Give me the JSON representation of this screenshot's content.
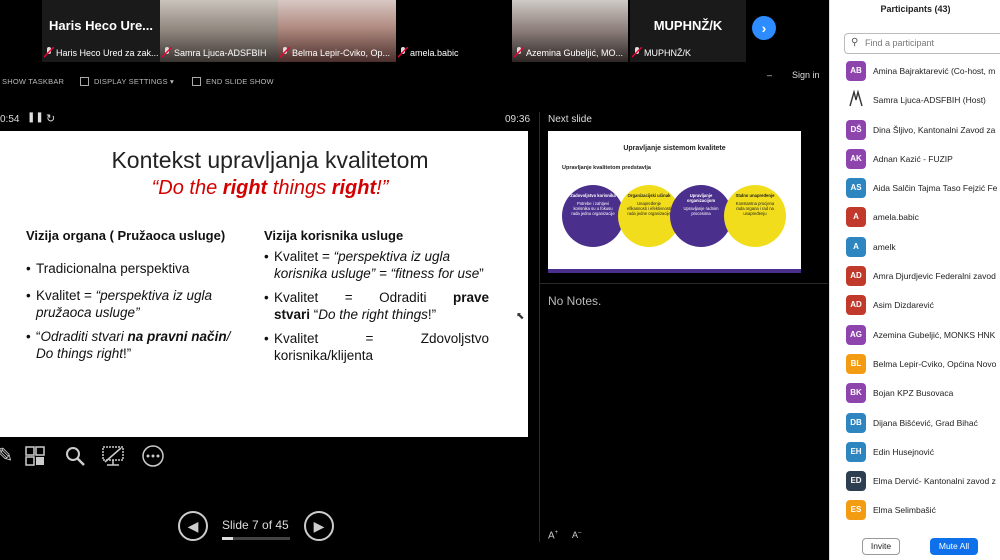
{
  "video_tiles": [
    {
      "name": "Haris Heco Ure...",
      "caption": "Haris Heco Ured za zak..."
    },
    {
      "name": "",
      "caption": "Samra Ljuca-ADSFBIH"
    },
    {
      "name": "",
      "caption": "Belma Lepir-Cviko, Op..."
    },
    {
      "name": "",
      "caption": "amela.babic"
    },
    {
      "name": "",
      "caption": "Azemina Gubeljić, MO..."
    },
    {
      "name": "MUPHNŽ/K",
      "caption": "MUPHNŽ/K"
    }
  ],
  "toolbar": {
    "show_taskbar": "SHOW TASKBAR",
    "display_settings": "DISPLAY SETTINGS ▾",
    "end_slide_show": "END SLIDE SHOW",
    "sign_in": "Sign in",
    "minimize": "–"
  },
  "timer": {
    "elapsed": "0:54",
    "clock": "09:36"
  },
  "slide": {
    "title": "Kontekst upravljanja kvalitetom",
    "subtitle_parts": [
      "“Do the ",
      "right",
      " things ",
      "right",
      "!”"
    ],
    "left_heading": "Vizija organa ( Pružaoca usluge)",
    "left_b1": "Tradicionalna perspektiva",
    "left_b2_a": "Kvalitet = ",
    "left_b2_b": "“perspektiva iz ugla pružaoca usluge”",
    "left_b3_a": "“",
    "left_b3_b": "Odraditi stvari ",
    "left_b3_c": "na pravni način",
    "left_b3_d": "/ Do things right",
    "left_b3_e": "!”",
    "right_heading": "Vizija korisnika usluge",
    "right_b1_a": "Kvalitet = ",
    "right_b1_b": "“perspektiva iz ugla korisnika usluge” = “fitness for use",
    "right_b1_c": "”",
    "right_b2_a": "Kvalitet",
    "right_b2_b": "=",
    "right_b2_c": "Odraditi",
    "right_b2_d": "prave",
    "right_b2_e": "stvari",
    "right_b2_f": " “",
    "right_b2_g": "Do the right things",
    "right_b2_h": "!”",
    "right_b3_a": "Kvalitet",
    "right_b3_b": "=",
    "right_b3_c": "Zdovoljstvo",
    "right_b3_d": "korisnika/klijenta"
  },
  "navigation": {
    "counter": "Slide 7 of 45",
    "progress": 0.156
  },
  "next_slide": {
    "label": "Next slide",
    "title": "Upravljanje sistemom kvalitete",
    "subtitle": "Upravljanje kvalitetom predstavlja",
    "circles": [
      {
        "title": "Zadovoljstvo korisnika",
        "desc": "Potrebe i zahtjevi korisnika su u fokusu rada jednu organizacije"
      },
      {
        "title": "Organizacijski učinak",
        "desc": "Unapređenje efikasnosti i efektivnosti rada jedne organizacije"
      },
      {
        "title": "Upravljanje organizacijom",
        "desc": "Upravljanje radnim procesima"
      },
      {
        "title": "Stalno unapređenje",
        "desc": "Konstantna procjena rada organa i rad na unapređenju"
      }
    ]
  },
  "notes": {
    "text": "No Notes."
  },
  "participants": {
    "header": "Participants (43)",
    "search_placeholder": "Find a participant",
    "list": [
      {
        "initials": "AB",
        "name": "Amina Bajraktarević (Co-host, m",
        "color": "#8e44ad"
      },
      {
        "initials": "",
        "name": "Samra Ljuca-ADSFBIH (Host)",
        "color": "#ffffff"
      },
      {
        "initials": "DŠ",
        "name": "Dina Šljivo, Kantonalni Zavod za",
        "color": "#8e44ad"
      },
      {
        "initials": "AK",
        "name": "Adnan Kazić - FUZIP",
        "color": "#8e44ad"
      },
      {
        "initials": "AS",
        "name": "Aida Salčin Tajma Taso Fejzić Fe",
        "color": "#2e86c1"
      },
      {
        "initials": "A",
        "name": "amela.babic",
        "color": "#c0392b"
      },
      {
        "initials": "A",
        "name": "amelk",
        "color": "#2e86c1"
      },
      {
        "initials": "AD",
        "name": "Amra Djurdjevic Federalni zavod",
        "color": "#c0392b"
      },
      {
        "initials": "AD",
        "name": "Asim Dizdarević",
        "color": "#c0392b"
      },
      {
        "initials": "AG",
        "name": "Azemina Gubeljić, MONKS HNK",
        "color": "#8e44ad"
      },
      {
        "initials": "BL",
        "name": "Belma Lepir-Cviko, Općina Novo",
        "color": "#f39c12"
      },
      {
        "initials": "BK",
        "name": "Bojan KPZ Busovaca",
        "color": "#8e44ad"
      },
      {
        "initials": "DB",
        "name": "Dijana Bišćević, Grad Bihać",
        "color": "#2e86c1"
      },
      {
        "initials": "EH",
        "name": "Edin Husejnović",
        "color": "#2e86c1"
      },
      {
        "initials": "ED",
        "name": "Elma Dervić- Kantonalni zavod z",
        "color": "#2c3e50"
      },
      {
        "initials": "ES",
        "name": "Elma Selimbašić",
        "color": "#f39c12"
      }
    ],
    "invite": "Invite",
    "mute_all": "Mute All"
  }
}
